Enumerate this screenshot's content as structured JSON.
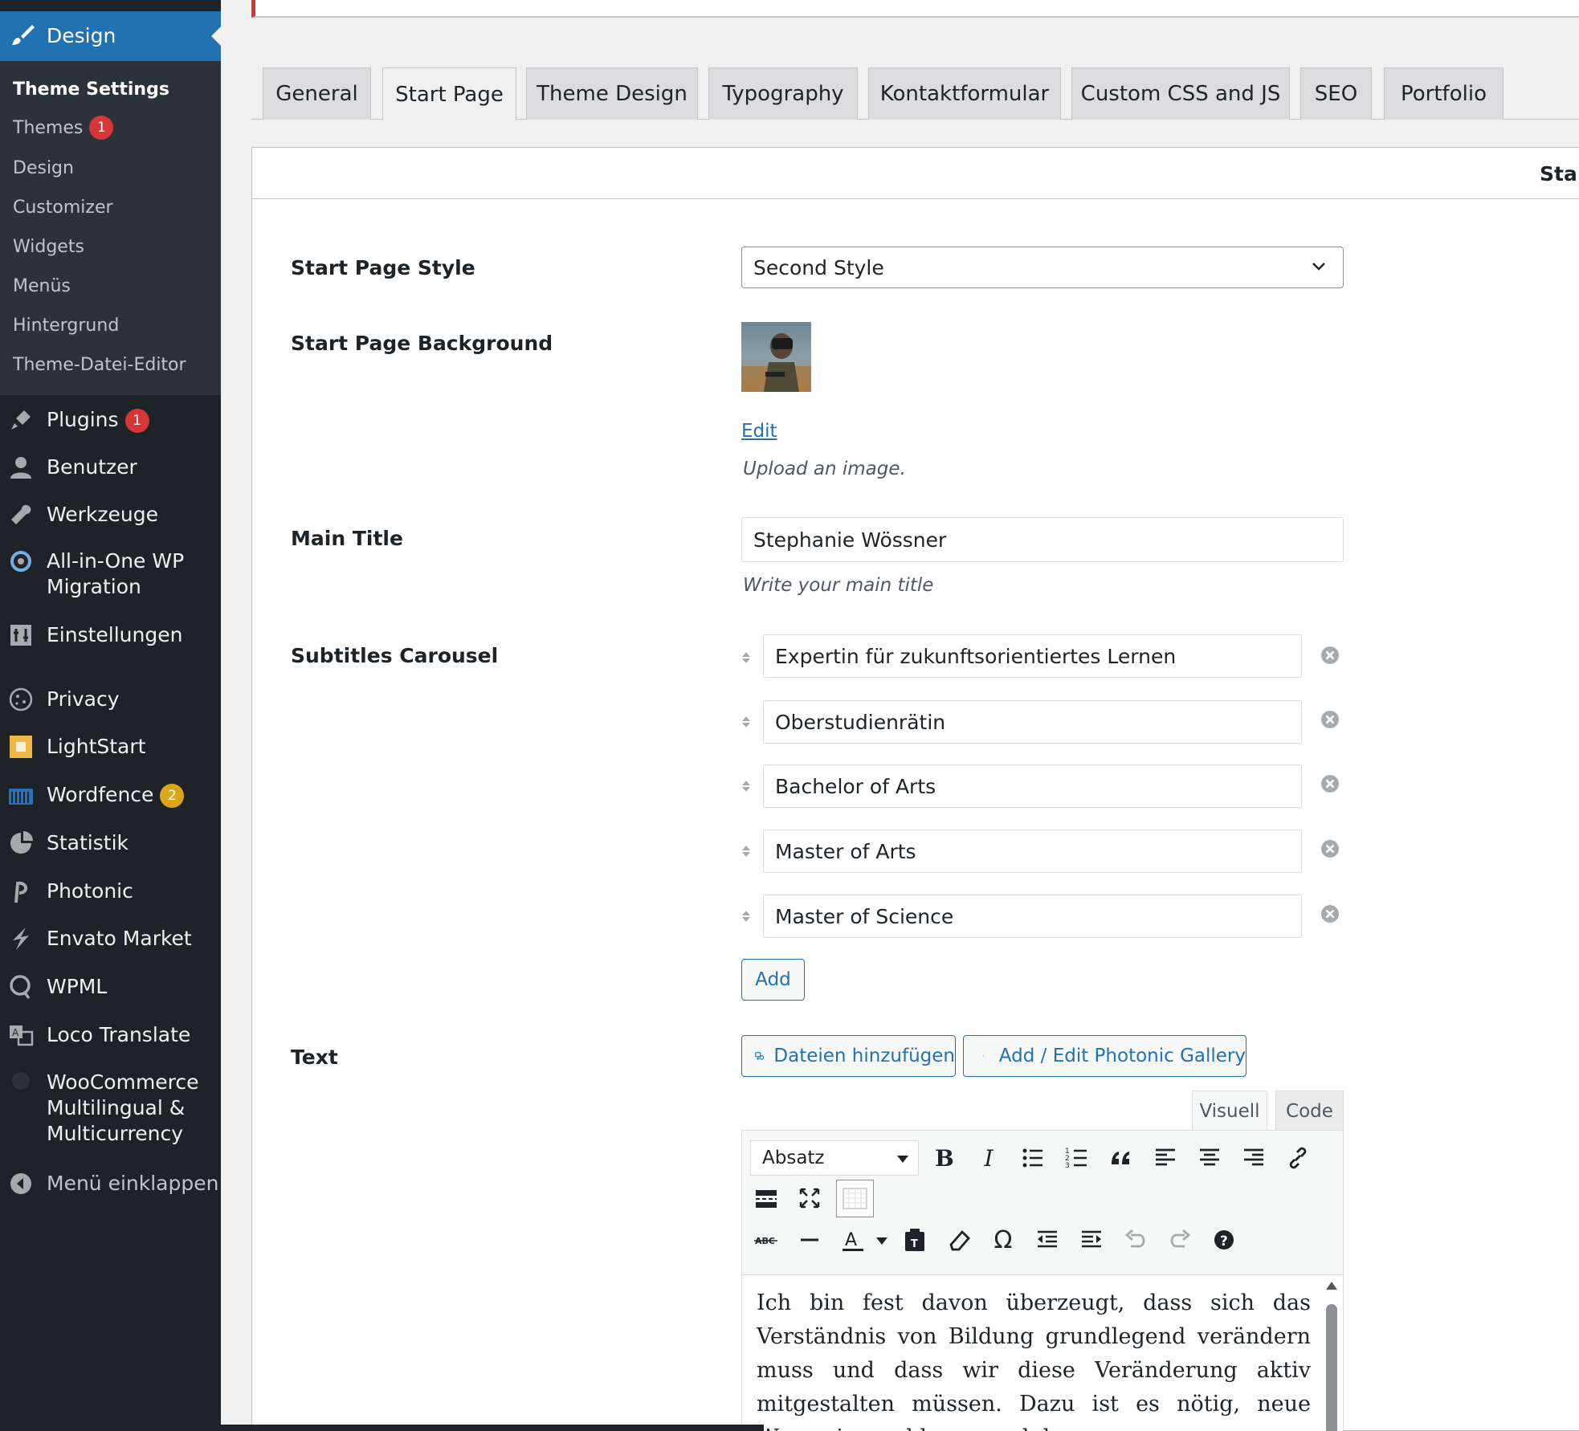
{
  "sidebar": {
    "active_menu": "Design",
    "submenu": [
      "Theme Settings",
      "Themes",
      "Design",
      "Customizer",
      "Widgets",
      "Menüs",
      "Hintergrund",
      "Theme-Datei-Editor"
    ],
    "themes_badge": "1",
    "menu": [
      {
        "label": "Plugins",
        "icon": "plugins-icon",
        "badge": "1"
      },
      {
        "label": "Benutzer",
        "icon": "user-icon"
      },
      {
        "label": "Werkzeuge",
        "icon": "wrench-icon"
      },
      {
        "label": "All-in-One WP Migration",
        "icon": "migration-icon"
      },
      {
        "label": "Einstellungen",
        "icon": "settings-icon"
      },
      {
        "label": "Privacy",
        "icon": "cookie-icon"
      },
      {
        "label": "LightStart",
        "icon": "lightstart-icon"
      },
      {
        "label": "Wordfence",
        "icon": "wordfence-icon",
        "badge": "2"
      },
      {
        "label": "Statistik",
        "icon": "pie-chart-icon"
      },
      {
        "label": "Photonic",
        "icon": "photonic-icon"
      },
      {
        "label": "Envato Market",
        "icon": "envato-icon"
      },
      {
        "label": "WPML",
        "icon": "wpml-icon"
      },
      {
        "label": "Loco Translate",
        "icon": "translate-icon"
      },
      {
        "label": "WooCommerce Multilingual & Multicurrency",
        "icon": "woocommerce-multilingual-icon"
      },
      {
        "label": "Menü einklappen",
        "icon": "collapse-icon"
      }
    ]
  },
  "tabs": [
    "General",
    "Start Page",
    "Theme Design",
    "Typography",
    "Kontaktformular",
    "Custom CSS and JS",
    "SEO",
    "Portfolio"
  ],
  "active_tab": "Start Page",
  "panel_title": "Start",
  "fields": {
    "start_page_style": {
      "label": "Start Page Style",
      "value": "Second Style"
    },
    "start_page_background": {
      "label": "Start Page Background",
      "edit_label": "Edit",
      "description": "Upload an image."
    },
    "main_title": {
      "label": "Main Title",
      "value": "Stephanie Wössner",
      "description": "Write your main title"
    },
    "subtitles": {
      "label": "Subtitles Carousel",
      "items": [
        "Expertin für zukunftsorientiertes Lernen",
        "Oberstudienrätin",
        "Bachelor of Arts",
        "Master of Arts",
        "Master of Science"
      ],
      "add_label": "Add"
    },
    "text": {
      "label": "Text",
      "add_media_label": "Dateien hinzufügen",
      "photonic_label": "Add / Edit Photonic Gallery",
      "tab_visual": "Visuell",
      "tab_code": "Code",
      "format_value": "Absatz",
      "content": "Ich bin fest davon überzeugt, dass sich das Verständnis von Bildung grundlegend verändern muss und dass wir diese Veränderung aktiv mitgestalten müssen. Dazu ist es nötig, neue Wege einzuschlagen und das"
    }
  },
  "colors": {
    "accent": "#2271b1",
    "sidebar_bg": "#1d2327",
    "badge_red": "#d63638",
    "badge_orange": "#dba617"
  }
}
